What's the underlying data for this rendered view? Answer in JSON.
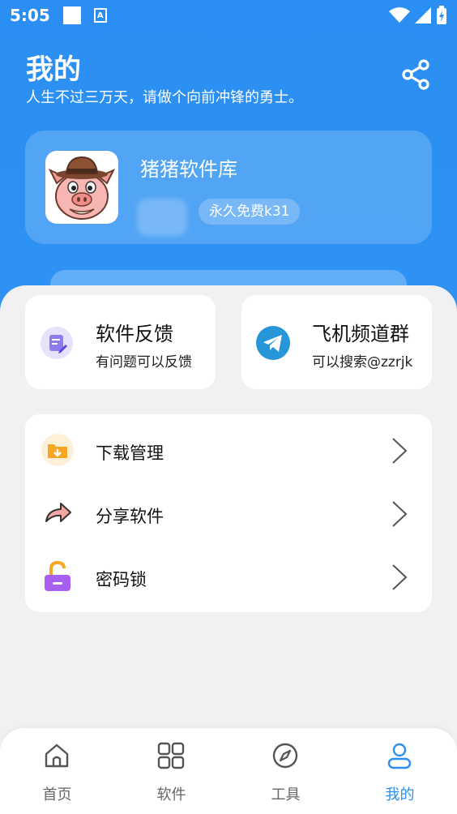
{
  "status_bar": {
    "time": "5:05",
    "a_icon_text": "A"
  },
  "header": {
    "title": "我的",
    "subtitle": "人生不过三万天，请做个向前冲锋的勇士。",
    "share_icon": "share-icon"
  },
  "profile": {
    "name": "猪猪软件库",
    "tag": "永久免费k31"
  },
  "quick_actions": [
    {
      "title": "软件反馈",
      "subtitle": "有问题可以反馈",
      "icon": "feedback-icon"
    },
    {
      "title": "飞机频道群",
      "subtitle": "可以搜索@zzrjk",
      "icon": "telegram-icon"
    }
  ],
  "menu": [
    {
      "label": "下载管理",
      "icon": "download-folder-icon"
    },
    {
      "label": "分享软件",
      "icon": "share-arrow-icon"
    },
    {
      "label": "密码锁",
      "icon": "lock-icon"
    }
  ],
  "bottom_nav": [
    {
      "label": "首页",
      "icon": "home-icon"
    },
    {
      "label": "软件",
      "icon": "grid-icon"
    },
    {
      "label": "工具",
      "icon": "compass-icon"
    },
    {
      "label": "我的",
      "icon": "user-icon",
      "active": true
    }
  ],
  "colors": {
    "primary": "#2b8ef2",
    "background": "#f1f1f3",
    "card": "#ffffff"
  }
}
